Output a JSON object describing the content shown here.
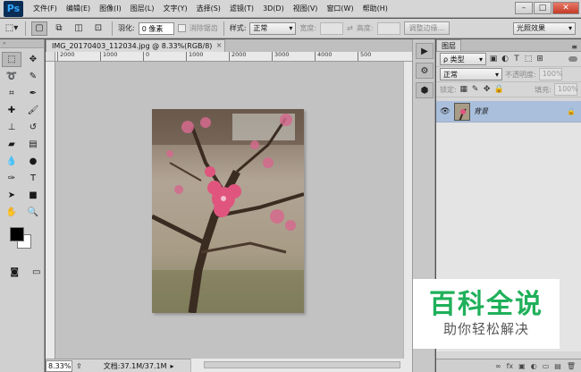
{
  "app": {
    "logo": "Ps"
  },
  "menu": [
    "文件(F)",
    "编辑(E)",
    "图像(I)",
    "图层(L)",
    "文字(Y)",
    "选择(S)",
    "滤镜(T)",
    "3D(D)",
    "视图(V)",
    "窗口(W)",
    "帮助(H)"
  ],
  "window_controls": {
    "minimize": "–",
    "maximize": "□",
    "close": "✕"
  },
  "options": {
    "feather_label": "羽化:",
    "feather_value": "0 像素",
    "antialias_label": "消除锯齿",
    "style_label": "样式:",
    "style_value": "正常",
    "width_label": "宽度:",
    "height_label": "高度:",
    "refine_edge": "调整边缘...",
    "workspace": "光照效果"
  },
  "document": {
    "tab_title": "IMG_20170403_112034.jpg @ 8.33%(RGB/8)",
    "close": "×",
    "ruler_ticks": [
      "2000",
      "1000",
      "0",
      "1000",
      "2000",
      "3000",
      "4000",
      "500"
    ],
    "zoom": "8.33%",
    "doc_info": "文档:37.1M/37.1M"
  },
  "layers_panel": {
    "tab": "图层",
    "filter_kind": "ρ 类型",
    "blend_mode": "正常",
    "opacity_label": "不透明度:",
    "opacity_value": "100%",
    "lock_label": "锁定:",
    "fill_label": "填充:",
    "fill_value": "100%",
    "layers": [
      {
        "name": "背景"
      }
    ],
    "footer_icons": [
      "∞",
      "fx",
      "▣",
      "◐",
      "▭",
      "▤",
      "🗑"
    ]
  },
  "watermark": {
    "main": "百科全说",
    "sub": "助你轻松解决"
  },
  "colors": {
    "accent_blue": "#aabfdc",
    "watermark_green": "#1fb05a"
  }
}
